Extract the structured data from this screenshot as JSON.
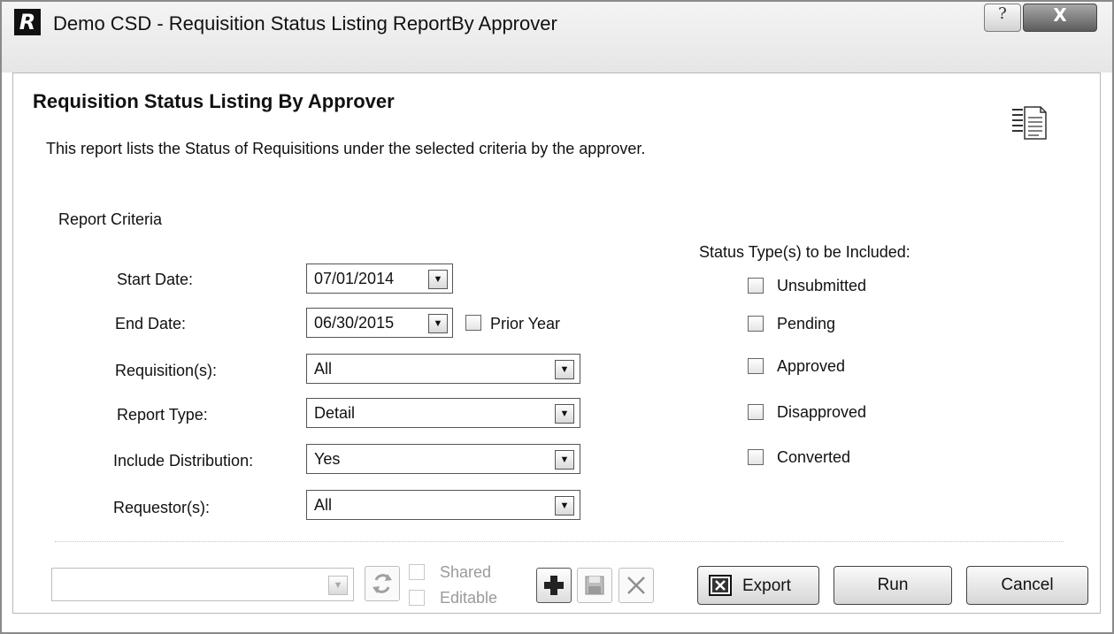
{
  "window": {
    "title": "Demo CSD - Requisition Status Listing ReportBy Approver",
    "logo_letter": "R"
  },
  "titlebar": {
    "help_glyph": "?",
    "close_glyph": "X"
  },
  "header": {
    "title": "Requisition Status Listing By Approver",
    "description": "This report lists the Status of Requisitions under the selected criteria by the approver."
  },
  "criteria": {
    "section_label": "Report Criteria",
    "start_date": {
      "label": "Start Date:",
      "value": "07/01/2014"
    },
    "end_date": {
      "label": "End Date:",
      "value": "06/30/2015"
    },
    "prior_year": {
      "label": "Prior Year",
      "checked": false
    },
    "requisitions": {
      "label": "Requisition(s):",
      "value": "All"
    },
    "report_type": {
      "label": "Report Type:",
      "value": "Detail"
    },
    "include_distribution": {
      "label": "Include Distribution:",
      "value": "Yes"
    },
    "requestors": {
      "label": "Requestor(s):",
      "value": "All"
    }
  },
  "status_types": {
    "header": "Status Type(s) to be Included:",
    "items": [
      {
        "label": "Unsubmitted",
        "checked": false
      },
      {
        "label": "Pending",
        "checked": false
      },
      {
        "label": "Approved",
        "checked": false
      },
      {
        "label": "Disapproved",
        "checked": false
      },
      {
        "label": "Converted",
        "checked": false
      }
    ]
  },
  "bottom": {
    "saved_report_select": {
      "value": ""
    },
    "shared_label": "Shared",
    "editable_label": "Editable",
    "export_label": "Export",
    "run_label": "Run",
    "cancel_label": "Cancel"
  },
  "icons": {
    "logo": "app-logo-icon",
    "report": "report-document-icon",
    "dropdown": "chevron-down-icon",
    "refresh": "refresh-icon",
    "add": "plus-icon",
    "save": "save-icon",
    "delete": "delete-x-icon",
    "export": "excel-icon"
  },
  "colors": {
    "window_bg": "#ffffff",
    "titlebar": "#e8e8e8",
    "close_button": "#6e6e6e",
    "text": "#111111",
    "disabled_text": "#9a9a9a"
  }
}
